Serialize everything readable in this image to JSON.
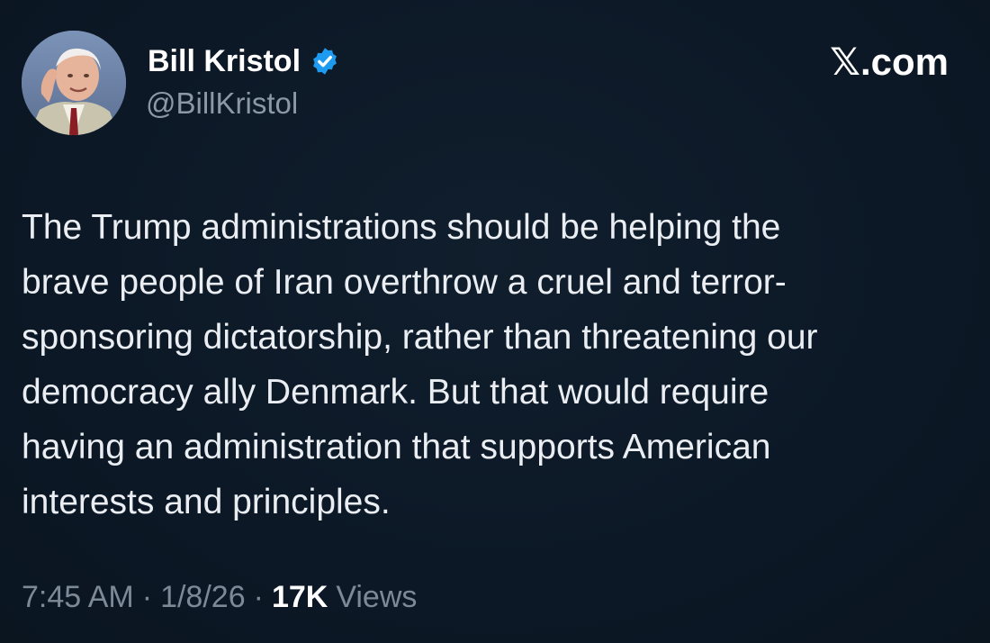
{
  "author": {
    "display_name": "Bill Kristol",
    "handle": "@BillKristol",
    "verified": true
  },
  "brand": "𝕏.com",
  "tweet": {
    "text": "The Trump administrations should be helping the\nbrave people of Iran overthrow a cruel and terror-\nsponsoring dictatorship, rather than threatening our\ndemocracy ally Denmark. But that would require\nhaving an administration that supports American\ninterests and principles."
  },
  "meta": {
    "time": "7:45 AM",
    "separator": "·",
    "date": "1/8/26",
    "views_count": "17K",
    "views_label": "Views"
  },
  "colors": {
    "background": "#0d1a28",
    "verified_badge": "#1d9bf0",
    "secondary_text": "#7c8997"
  },
  "icons": {
    "verified": "verified-badge-icon",
    "avatar": "profile-avatar"
  }
}
